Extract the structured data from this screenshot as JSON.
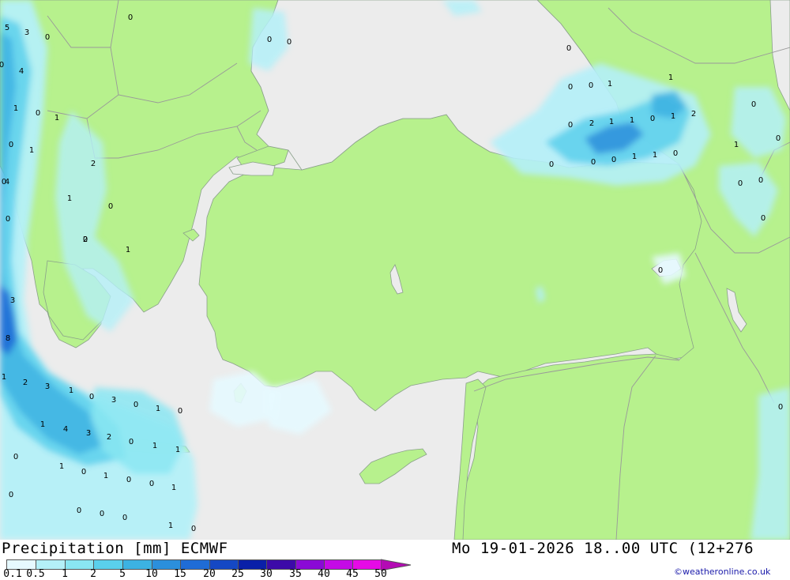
{
  "map": {
    "title": "Precipitation [mm] ECMWF",
    "valid_time": "Mo 19-01-2026 18..00 UTC (12+276",
    "credit": "©weatheronline.co.uk"
  },
  "legend": {
    "ticks": [
      "0.1",
      "0.5",
      "1",
      "2",
      "5",
      "10",
      "15",
      "20",
      "25",
      "30",
      "35",
      "40",
      "45",
      "50"
    ],
    "colors": [
      "#e6f9ff",
      "#b4f0f8",
      "#8ae6f2",
      "#5ad0ec",
      "#3cb2e2",
      "#2b8fdc",
      "#1f6cd6",
      "#1548c4",
      "#0a20a8",
      "#3c0aa8",
      "#8a0ad6",
      "#c40ae6",
      "#e60ae6",
      "#b40ab4"
    ]
  },
  "colors": {
    "land": "#b7f18d",
    "sea": "#ececec",
    "border": "#999999"
  },
  "values": [
    {
      "t": "5"
    },
    {
      "t": "3"
    },
    {
      "t": "0"
    },
    {
      "t": "0"
    },
    {
      "t": "1"
    },
    {
      "t": "4"
    },
    {
      "t": "0"
    },
    {
      "t": "1"
    },
    {
      "t": "0"
    },
    {
      "t": "1"
    },
    {
      "t": "0"
    },
    {
      "t": "0"
    },
    {
      "t": "2"
    },
    {
      "t": "4"
    },
    {
      "t": "1"
    },
    {
      "t": "0"
    },
    {
      "t": "0"
    },
    {
      "t": "2"
    },
    {
      "t": "1"
    },
    {
      "t": "3"
    },
    {
      "t": "8"
    },
    {
      "t": "1"
    },
    {
      "t": "2"
    },
    {
      "t": "3"
    },
    {
      "t": "1"
    },
    {
      "t": "0"
    },
    {
      "t": "3"
    },
    {
      "t": "0"
    },
    {
      "t": "1"
    },
    {
      "t": "0"
    },
    {
      "t": "1"
    },
    {
      "t": "4"
    },
    {
      "t": "3"
    },
    {
      "t": "2"
    },
    {
      "t": "0"
    },
    {
      "t": "1"
    },
    {
      "t": "1"
    },
    {
      "t": "0"
    },
    {
      "t": "1"
    },
    {
      "t": "0"
    },
    {
      "t": "1"
    },
    {
      "t": "0"
    },
    {
      "t": "0"
    },
    {
      "t": "1"
    },
    {
      "t": "0"
    },
    {
      "t": "0"
    },
    {
      "t": "0"
    },
    {
      "t": "0"
    },
    {
      "t": "1"
    },
    {
      "t": "0"
    },
    {
      "t": "0"
    },
    {
      "t": "0"
    },
    {
      "t": "0"
    },
    {
      "t": "0"
    },
    {
      "t": "1"
    },
    {
      "t": "0"
    },
    {
      "t": "0"
    },
    {
      "t": "1"
    },
    {
      "t": "0"
    },
    {
      "t": "0"
    },
    {
      "t": "2"
    },
    {
      "t": "1"
    },
    {
      "t": "1"
    },
    {
      "t": "0"
    },
    {
      "t": "1"
    },
    {
      "t": "2"
    },
    {
      "t": "1"
    },
    {
      "t": "0"
    },
    {
      "t": "0"
    },
    {
      "t": "0"
    },
    {
      "t": "0"
    },
    {
      "t": "1"
    },
    {
      "t": "1"
    },
    {
      "t": "0"
    },
    {
      "t": "0"
    },
    {
      "t": "0"
    },
    {
      "t": "0"
    },
    {
      "t": "0"
    },
    {
      "t": "0"
    }
  ]
}
